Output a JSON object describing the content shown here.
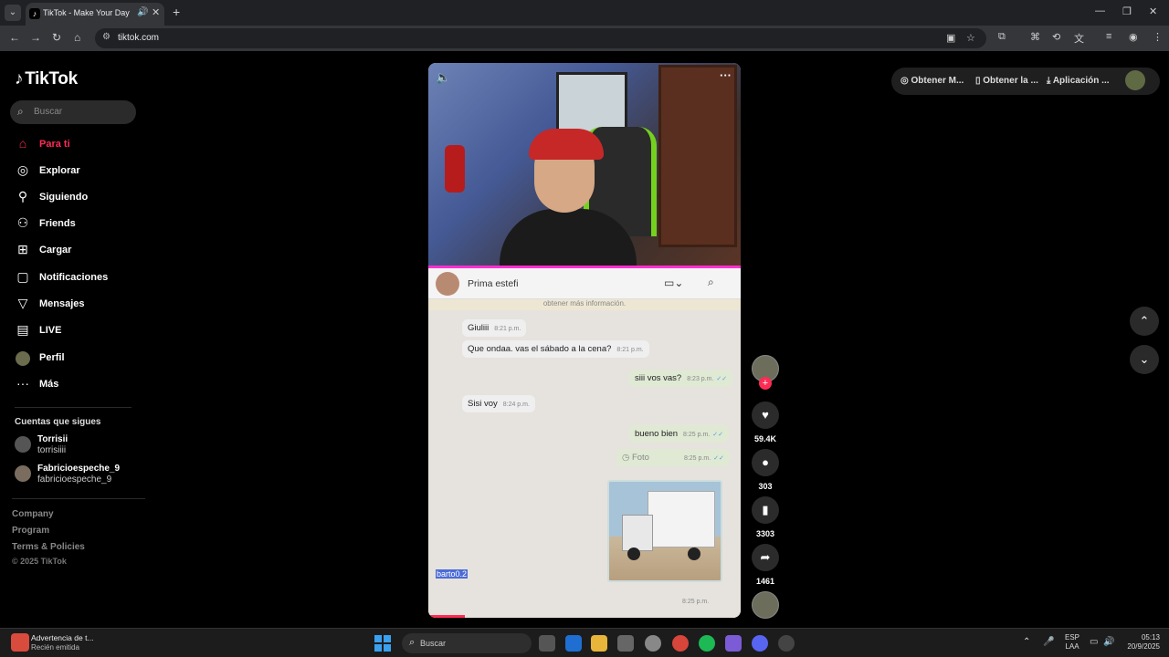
{
  "browser": {
    "tab_title": "TikTok - Make Your Day",
    "url": "tiktok.com"
  },
  "sidebar": {
    "logo": "TikTok",
    "search_placeholder": "Buscar",
    "nav": [
      {
        "label": "Para ti",
        "icon": "home-icon",
        "active": true
      },
      {
        "label": "Explorar",
        "icon": "compass-icon"
      },
      {
        "label": "Siguiendo",
        "icon": "user-icon"
      },
      {
        "label": "Friends",
        "icon": "friends-icon"
      },
      {
        "label": "Cargar",
        "icon": "upload-icon"
      },
      {
        "label": "Notificaciones",
        "icon": "inbox-icon"
      },
      {
        "label": "Mensajes",
        "icon": "send-icon"
      },
      {
        "label": "LIVE",
        "icon": "live-icon"
      },
      {
        "label": "Perfil",
        "icon": "avatar-icon"
      },
      {
        "label": "Más",
        "icon": "more-icon"
      }
    ],
    "following_title": "Cuentas que sigues",
    "following": [
      {
        "name": "Torrisii",
        "username": "torrisiiii"
      },
      {
        "name": "Fabricioespeche_9",
        "username": "fabricioespeche_9"
      }
    ],
    "footer": [
      "Company",
      "Program",
      "Terms & Policies"
    ],
    "copyright": "© 2025 TikTok"
  },
  "video": {
    "chat_contact": "Prima estefi",
    "chat_info": "obtener más información.",
    "messages": [
      {
        "dir": "in",
        "text": "Giuliii",
        "time": "8:21 p.m."
      },
      {
        "dir": "in",
        "text": "Que ondaa. vas el sábado a la cena?",
        "time": "8:21 p.m."
      },
      {
        "dir": "out",
        "text": "siii vos vas?",
        "time": "8:23 p.m."
      },
      {
        "dir": "in",
        "text": "Sisi voy",
        "time": "8:24 p.m."
      },
      {
        "dir": "out",
        "text": "bueno bien",
        "time": "8:25 p.m."
      },
      {
        "dir": "out",
        "text": "Foto",
        "time": "8:25 p.m."
      }
    ],
    "photo_time": "8:25 p.m.",
    "caption_user": "barto0.2"
  },
  "actions": {
    "likes": "59.4K",
    "comments": "303",
    "saves": "3303",
    "shares": "1461"
  },
  "top_links": [
    "Obtener M...",
    "Obtener la ...",
    "Aplicación ..."
  ],
  "taskbar": {
    "notif_title": "Advertencia de t...",
    "notif_sub": "Recién emitida",
    "search": "Buscar",
    "lang_1": "ESP",
    "lang_2": "LAA",
    "time": "05:13",
    "date": "20/9/2025"
  }
}
